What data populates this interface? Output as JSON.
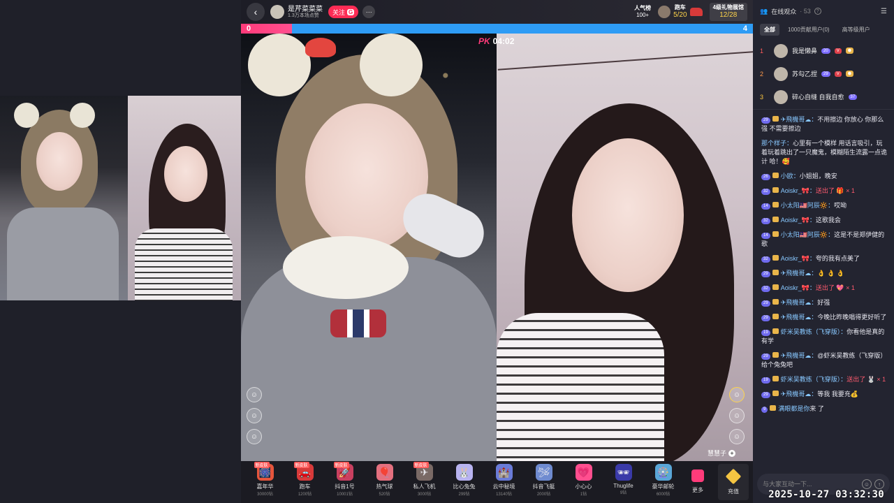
{
  "stream_header": {
    "back_icon": "chevron-left-icon",
    "anchor_name": "是芹菜菜菜",
    "anchor_sub": "1.3万本场点赞",
    "follow_label": "关注",
    "follow_g": "G",
    "more_label": "···",
    "popularity_label": "人气榜",
    "popularity_value": "100+",
    "car_label": "跑车",
    "car_value": "5/20",
    "giftwall_label": "4级礼物展馆",
    "giftwall_value": "12/28"
  },
  "pk": {
    "left_score": "0",
    "right_score": "4",
    "left_share": 0.1,
    "timer_logo": "PK",
    "timer": "04:02"
  },
  "host_tag": {
    "name": "慧慧子",
    "plus": "+"
  },
  "gifts": [
    {
      "tag": "新皮肤",
      "icon": "carnival-icon",
      "glyph": "🎆",
      "name": "嘉年华",
      "price": "30000钻",
      "color": "#e5553c"
    },
    {
      "tag": "新皮肤",
      "icon": "sports-car-icon",
      "glyph": "🚗",
      "name": "跑车",
      "price": "1200钻",
      "color": "#d83a3a"
    },
    {
      "tag": "新皮肤",
      "icon": "rocket-icon",
      "glyph": "🚀",
      "name": "抖音1号",
      "price": "10001钻",
      "color": "#c94060"
    },
    {
      "tag": "",
      "icon": "balloon-icon",
      "glyph": "🎈",
      "name": "热气球",
      "price": "520钻",
      "color": "#e4707f"
    },
    {
      "tag": "新皮肤",
      "icon": "jet-icon",
      "glyph": "✈",
      "name": "私人飞机",
      "price": "3000钻",
      "color": "#7a6a66"
    },
    {
      "tag": "",
      "icon": "bunny-icon",
      "glyph": "🐰",
      "name": "比心兔兔",
      "price": "299钻",
      "color": "#b8b3f0"
    },
    {
      "tag": "",
      "icon": "castle-icon",
      "glyph": "🏰",
      "name": "云中秘境",
      "price": "13140钻",
      "color": "#6a7bd8"
    },
    {
      "tag": "",
      "icon": "plane-icon",
      "glyph": "🛩",
      "name": "抖音飞艇",
      "price": "2000钻",
      "color": "#6f8bd0"
    },
    {
      "tag": "",
      "icon": "heart-icon",
      "glyph": "💗",
      "name": "小心心",
      "price": "1钻",
      "color": "#ff4f8f"
    },
    {
      "tag": "",
      "icon": "sunglasses-icon",
      "glyph": "🕶",
      "name": "Thuglife",
      "price": "9钻",
      "color": "#3a3aa8"
    },
    {
      "tag": "",
      "icon": "ferris-wheel-icon",
      "glyph": "🎡",
      "name": "豪华邮轮",
      "price": "6000钻",
      "color": "#5aa7d8"
    }
  ],
  "more_gifts_label": "更多",
  "recharge_label": "充值",
  "panel": {
    "title": "在线观众",
    "count": "· 53",
    "tabs": [
      "全部",
      "1000贡献用户(0)",
      "高等级用户"
    ],
    "ranks": [
      {
        "no": "1",
        "name": "我是懒鼻",
        "level": "20",
        "v": "V",
        "fan": "⬢"
      },
      {
        "no": "2",
        "name": "苏勾乙捏",
        "level": "29",
        "v": "V",
        "fan": "⬢"
      },
      {
        "no": "3",
        "name": "碎心自缝 自我自愈",
        "level": "37",
        "v": "",
        "fan": ""
      }
    ]
  },
  "chat": [
    {
      "level": "29",
      "user": "✈飛機哥☁：",
      "text": "不用擦边 你放心 你那么强 不需要擦边",
      "gift": ""
    },
    {
      "level": "",
      "user": "那个样子：",
      "text": "心里有一个模样 用话言吸引，玩着玩着跳出了一只魔鬼，模糊陌生流露一点诡计 哈！🥰",
      "gift": ""
    },
    {
      "level": "26",
      "user": "小欧：",
      "text": "小姐姐，晚安",
      "gift": ""
    },
    {
      "level": "32",
      "user": "Aoiskr_🎀：",
      "text": "",
      "gift": "送出了 🎁 × 1"
    },
    {
      "level": "14",
      "user": "小太阳🇲🇾阿辰🔆：",
      "text": "哎呦",
      "gift": ""
    },
    {
      "level": "32",
      "user": "Aoiskr_🎀：",
      "text": "这歌我会",
      "gift": ""
    },
    {
      "level": "14",
      "user": "小太阳🇲🇾阿辰🔆：",
      "text": "这是不是郑伊健的歌",
      "gift": ""
    },
    {
      "level": "32",
      "user": "Aoiskr_🎀：",
      "text": "夸的我有点美了",
      "gift": ""
    },
    {
      "level": "29",
      "user": "✈飛機哥☁：",
      "text": "👌 👌 👌",
      "gift": ""
    },
    {
      "level": "32",
      "user": "Aoiskr_🎀：",
      "text": "",
      "gift": "送出了 💖 × 1"
    },
    {
      "level": "29",
      "user": "✈飛機哥☁：",
      "text": "好强",
      "gift": ""
    },
    {
      "level": "29",
      "user": "✈飛機哥☁：",
      "text": "今晚比昨晚唱得更好听了",
      "gift": ""
    },
    {
      "level": "19",
      "user": "虾米吴教练（飞穿版）：",
      "text": "你看他是真的有学",
      "gift": ""
    },
    {
      "level": "29",
      "user": "✈飛機哥☁：",
      "text": "@虾米吴教练（飞穿版） 给个兔兔吧",
      "gift": ""
    },
    {
      "level": "19",
      "user": "虾米吴教练（飞穿版）：",
      "text": "",
      "gift": "送出了 🐰 × 1"
    },
    {
      "level": "29",
      "user": "✈飛機哥☁：",
      "text": "等我 我要充💰",
      "gift": ""
    },
    {
      "level": "9",
      "user": "满眼都是你",
      "text": "来 了",
      "gift": ""
    }
  ],
  "input": {
    "placeholder": "与大家互动一下...",
    "emoji_icon": "emoji-icon",
    "send_icon": "send-icon"
  },
  "timestamp": "2025-10-27 03:32:30"
}
